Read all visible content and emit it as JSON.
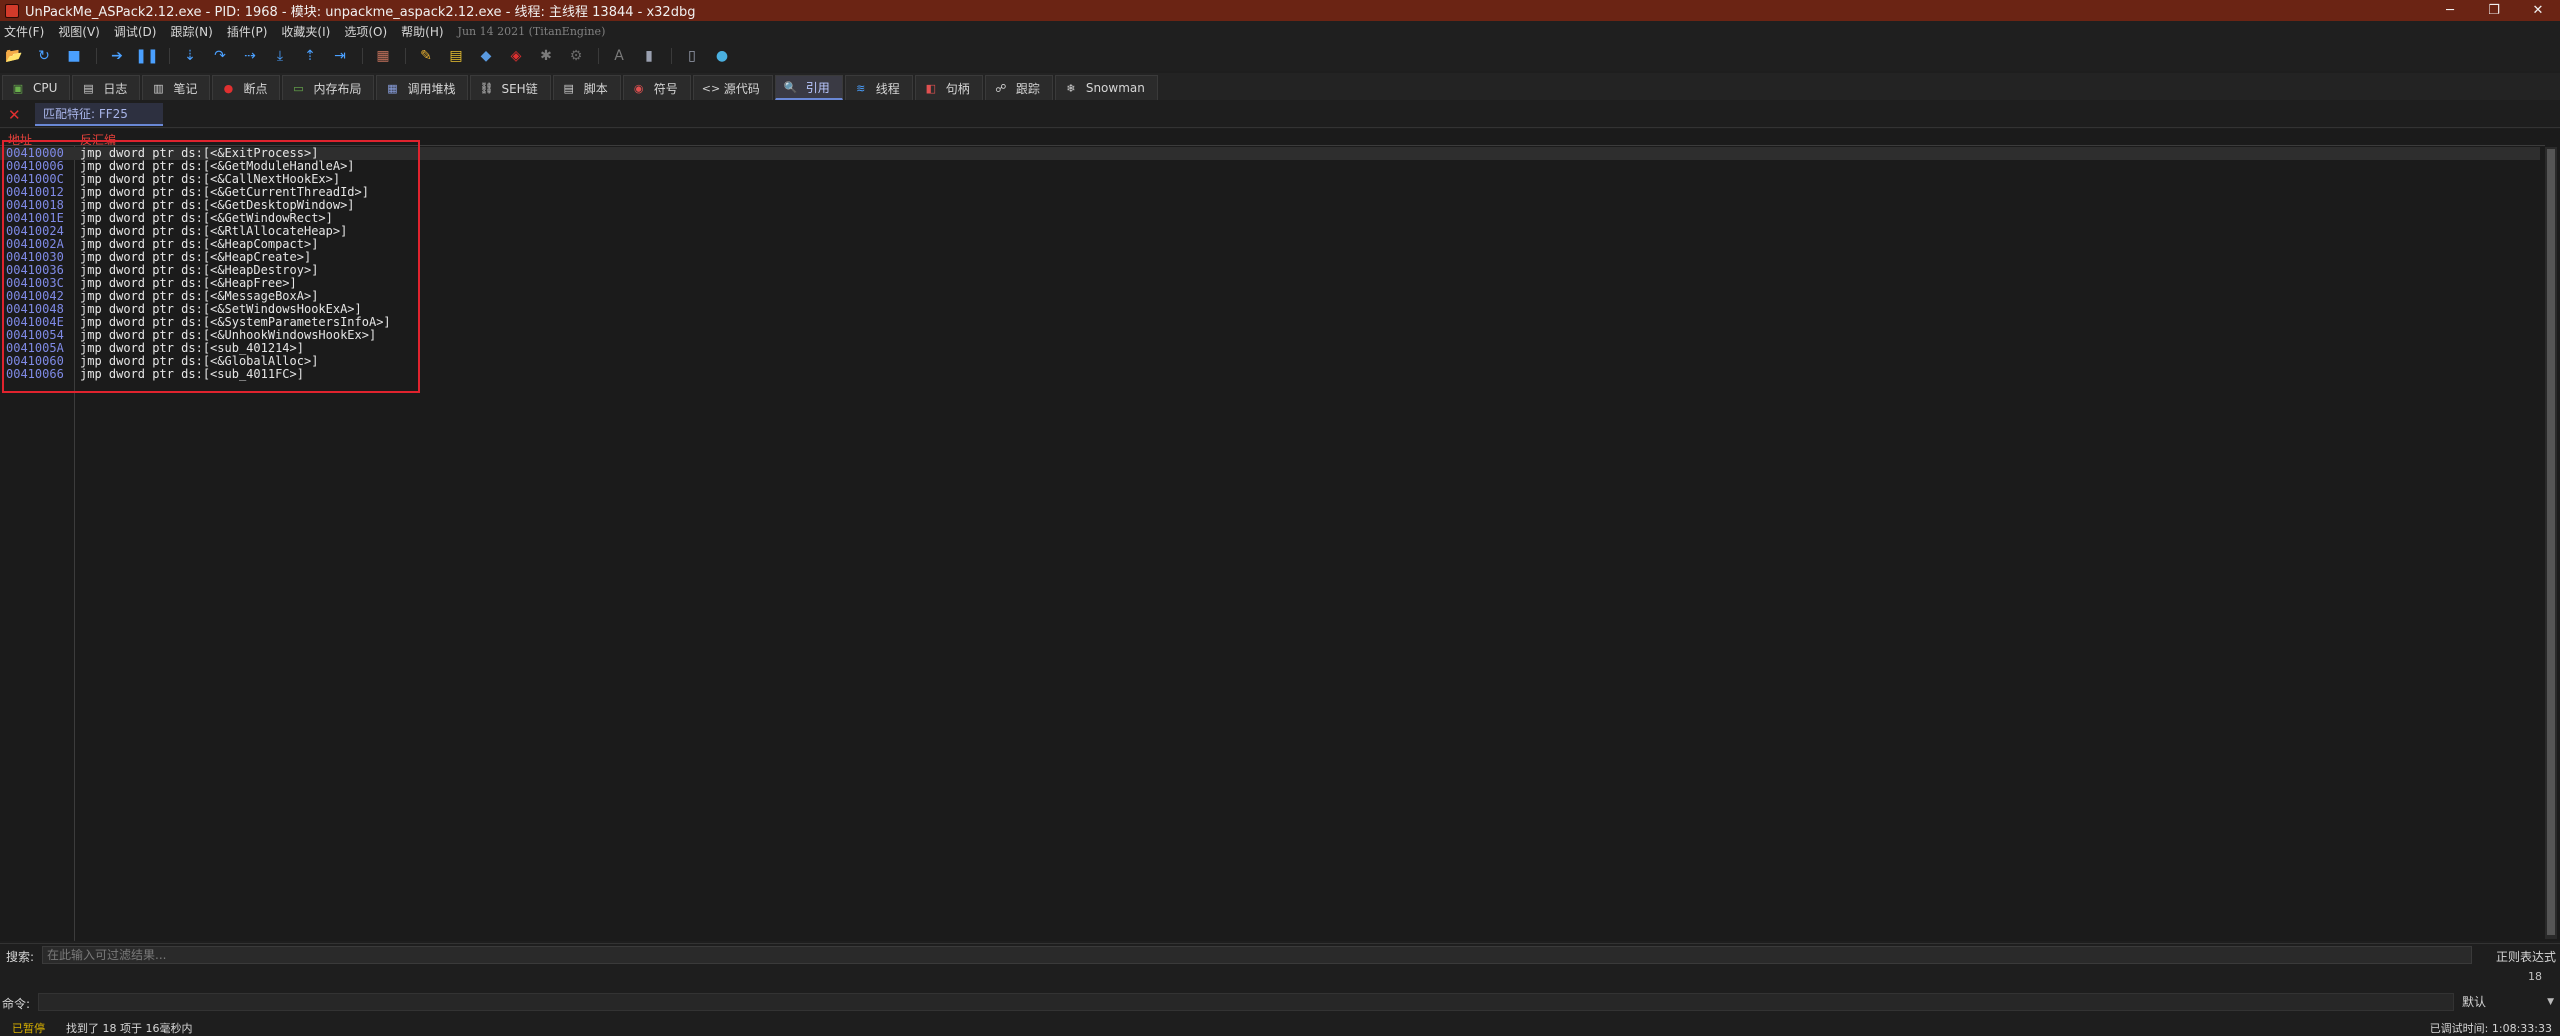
{
  "window": {
    "title": "UnPackMe_ASPack2.12.exe - PID: 1968 - 模块: unpackme_aspack2.12.exe - 线程: 主线程 13844 - x32dbg",
    "minimize": "─",
    "maximize": "❐",
    "close": "✕"
  },
  "menu": [
    "文件(F)",
    "视图(V)",
    "调试(D)",
    "跟踪(N)",
    "插件(P)",
    "收藏夹(I)",
    "选项(O)",
    "帮助(H)",
    "Jun 14 2021 (TitanEngine)"
  ],
  "toolbar_icons": [
    {
      "name": "open-icon",
      "glyph": "📂",
      "color": "#e8b030"
    },
    {
      "name": "restart-icon",
      "glyph": "↻",
      "color": "#4aa0ff"
    },
    {
      "name": "stop-icon",
      "glyph": "■",
      "color": "#4aa0ff"
    },
    {
      "name": "run-icon",
      "glyph": "➔",
      "color": "#4aa0ff"
    },
    {
      "name": "pause-icon",
      "glyph": "❚❚",
      "color": "#4aa0ff"
    },
    {
      "name": "step-into-icon",
      "glyph": "⇣",
      "color": "#4aa0ff"
    },
    {
      "name": "step-over-icon",
      "glyph": "↷",
      "color": "#4aa0ff"
    },
    {
      "name": "trace-into-icon",
      "glyph": "⇢",
      "color": "#4aa0ff"
    },
    {
      "name": "trace-over-icon",
      "glyph": "⤓",
      "color": "#4aa0ff"
    },
    {
      "name": "execute-till-return-icon",
      "glyph": "⇡",
      "color": "#4aa0ff"
    },
    {
      "name": "run-to-user-code-icon",
      "glyph": "⇥",
      "color": "#4aa0ff"
    },
    {
      "name": "scylla-icon",
      "glyph": "▦",
      "color": "#c0705a"
    },
    {
      "name": "patch-icon",
      "glyph": "✎",
      "color": "#e8b030"
    },
    {
      "name": "comments-icon",
      "glyph": "▤",
      "color": "#e8c030"
    },
    {
      "name": "labels-icon",
      "glyph": "◆",
      "color": "#5a9ae0"
    },
    {
      "name": "bookmarks-icon",
      "glyph": "◈",
      "color": "#e03030"
    },
    {
      "name": "functions-icon",
      "glyph": "✱",
      "color": "#7a7a7a"
    },
    {
      "name": "breakpoint-toggle-icon",
      "glyph": "⚙",
      "color": "#6a6a6a"
    },
    {
      "name": "font-icon",
      "glyph": "A",
      "color": "#7a7a7a"
    },
    {
      "name": "calculator-icon",
      "glyph": "▮",
      "color": "#9aa0b0"
    },
    {
      "name": "memory-map-icon",
      "glyph": "▯",
      "color": "#9aa0b0"
    },
    {
      "name": "globe-icon",
      "glyph": "●",
      "color": "#4ab0e0"
    }
  ],
  "tabs": [
    {
      "label": "CPU",
      "icon": "cpu-icon",
      "glyph": "▣",
      "color": "#6ab04c"
    },
    {
      "label": "日志",
      "icon": "log-icon",
      "glyph": "▤",
      "color": "#d0d0d0"
    },
    {
      "label": "笔记",
      "icon": "notes-icon",
      "glyph": "▥",
      "color": "#d0d0d0"
    },
    {
      "label": "断点",
      "icon": "breakpoint-icon",
      "glyph": "●",
      "color": "#e03030"
    },
    {
      "label": "内存布局",
      "icon": "memory-layout-icon",
      "glyph": "▭",
      "color": "#6ab04c"
    },
    {
      "label": "调用堆栈",
      "icon": "call-stack-icon",
      "glyph": "▦",
      "color": "#8aa0e0"
    },
    {
      "label": "SEH链",
      "icon": "seh-icon",
      "glyph": "⛓",
      "color": "#d0d0d0"
    },
    {
      "label": "脚本",
      "icon": "script-icon",
      "glyph": "▤",
      "color": "#d0d0d0"
    },
    {
      "label": "符号",
      "icon": "symbols-icon",
      "glyph": "◉",
      "color": "#e05050"
    },
    {
      "label": "源代码",
      "icon": "source-icon",
      "glyph": "<>",
      "color": "#d0d0d0"
    },
    {
      "label": "引用",
      "icon": "references-icon",
      "glyph": "🔍",
      "color": "#d0d0d0",
      "active": true
    },
    {
      "label": "线程",
      "icon": "threads-icon",
      "glyph": "≋",
      "color": "#4aa0ff"
    },
    {
      "label": "句柄",
      "icon": "handles-icon",
      "glyph": "◧",
      "color": "#e05050"
    },
    {
      "label": "跟踪",
      "icon": "trace-icon",
      "glyph": "☍",
      "color": "#d0d0d0"
    },
    {
      "label": "Snowman",
      "icon": "snowman-icon",
      "glyph": "❄",
      "color": "#d0d0d0"
    }
  ],
  "subtab": {
    "label": "匹配特征: FF25"
  },
  "columns": {
    "address": "地址",
    "disassembly": "反汇编"
  },
  "rows": [
    {
      "address": "00410000",
      "disasm": "jmp dword ptr ds:[<&ExitProcess>]"
    },
    {
      "address": "00410006",
      "disasm": "jmp dword ptr ds:[<&GetModuleHandleA>]"
    },
    {
      "address": "0041000C",
      "disasm": "jmp dword ptr ds:[<&CallNextHookEx>]"
    },
    {
      "address": "00410012",
      "disasm": "jmp dword ptr ds:[<&GetCurrentThreadId>]"
    },
    {
      "address": "00410018",
      "disasm": "jmp dword ptr ds:[<&GetDesktopWindow>]"
    },
    {
      "address": "0041001E",
      "disasm": "jmp dword ptr ds:[<&GetWindowRect>]"
    },
    {
      "address": "00410024",
      "disasm": "jmp dword ptr ds:[<&RtlAllocateHeap>]"
    },
    {
      "address": "0041002A",
      "disasm": "jmp dword ptr ds:[<&HeapCompact>]"
    },
    {
      "address": "00410030",
      "disasm": "jmp dword ptr ds:[<&HeapCreate>]"
    },
    {
      "address": "00410036",
      "disasm": "jmp dword ptr ds:[<&HeapDestroy>]"
    },
    {
      "address": "0041003C",
      "disasm": "jmp dword ptr ds:[<&HeapFree>]"
    },
    {
      "address": "00410042",
      "disasm": "jmp dword ptr ds:[<&MessageBoxA>]"
    },
    {
      "address": "00410048",
      "disasm": "jmp dword ptr ds:[<&SetWindowsHookExA>]"
    },
    {
      "address": "0041004E",
      "disasm": "jmp dword ptr ds:[<&SystemParametersInfoA>]"
    },
    {
      "address": "00410054",
      "disasm": "jmp dword ptr ds:[<&UnhookWindowsHookEx>]"
    },
    {
      "address": "0041005A",
      "disasm": "jmp dword ptr ds:[<sub_401214>]"
    },
    {
      "address": "00410060",
      "disasm": "jmp dword ptr ds:[<&GlobalAlloc>]"
    },
    {
      "address": "00410066",
      "disasm": "jmp dword ptr ds:[<sub_4011FC>]"
    }
  ],
  "search": {
    "label": "搜索:",
    "placeholder": "在此输入可过滤结果...",
    "regex_label": "正则表达式"
  },
  "result_count": "18",
  "command": {
    "label": "命令:",
    "mode": "默认"
  },
  "status": {
    "state": "已暂停",
    "message": "找到了 18 项于 16毫秒内",
    "elapsed": "已调试时间: 1:08:33:33"
  },
  "colors": {
    "titlebar": "#6b2414",
    "highlight_box": "#e0232e",
    "address": "#7f8ae6",
    "column_header": "#e2403a",
    "paused": "#d8b000"
  }
}
